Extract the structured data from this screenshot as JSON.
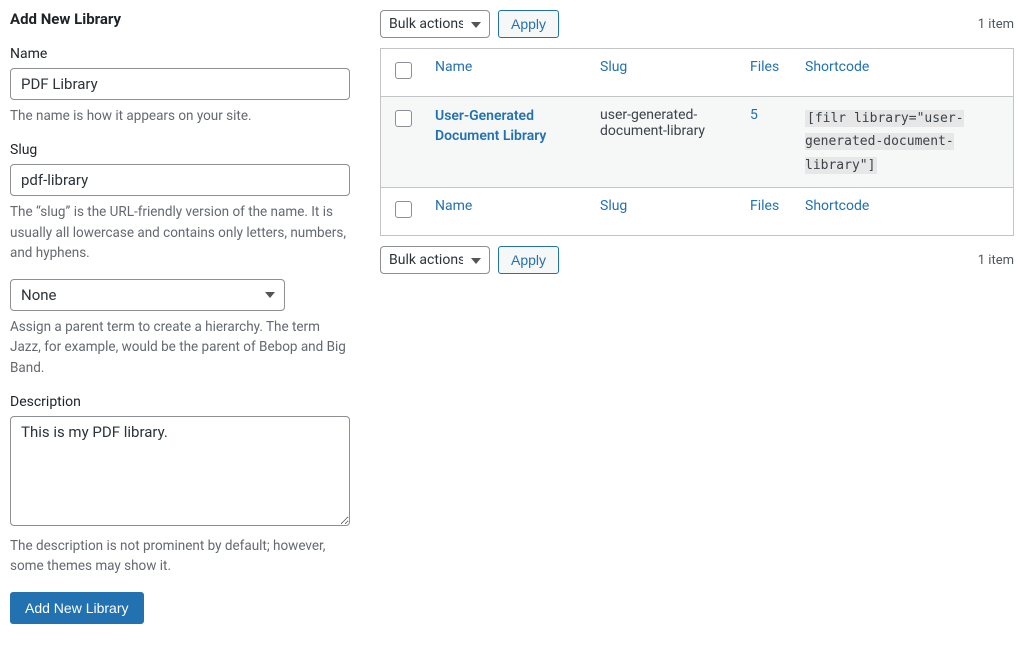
{
  "form": {
    "heading": "Add New Library",
    "name": {
      "label": "Name",
      "value": "PDF Library",
      "desc": "The name is how it appears on your site."
    },
    "slug": {
      "label": "Slug",
      "value": "pdf-library",
      "desc": "The “slug” is the URL-friendly version of the name. It is usually all lowercase and contains only letters, numbers, and hyphens."
    },
    "parent": {
      "selected": "None",
      "desc": "Assign a parent term to create a hierarchy. The term Jazz, for example, would be the parent of Bebop and Big Band."
    },
    "description": {
      "label": "Description",
      "value": "This is my PDF library.",
      "desc": "The description is not prominent by default; however, some themes may show it."
    },
    "submit_label": "Add New Library"
  },
  "list": {
    "bulk_label": "Bulk actions",
    "apply_label": "Apply",
    "item_count": "1 item",
    "columns": {
      "name": "Name",
      "slug": "Slug",
      "files": "Files",
      "shortcode": "Shortcode"
    },
    "rows": [
      {
        "name": "User-Generated Document Library",
        "slug": "user-generated-document-library",
        "files": "5",
        "shortcode": "[filr library=\"user-generated-document-library\"]"
      }
    ]
  }
}
